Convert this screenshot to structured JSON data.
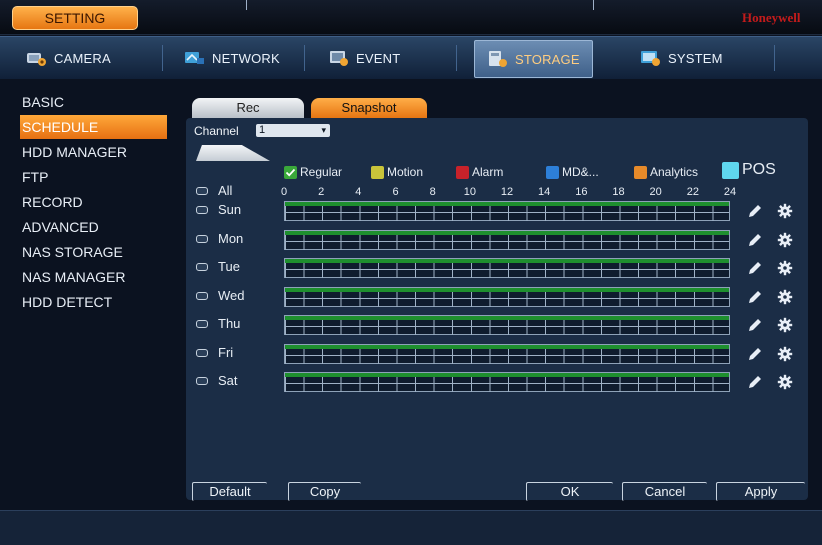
{
  "topbar": {
    "setting_label": "SETTING",
    "brand": "Honeywell"
  },
  "nav": {
    "tabs": [
      {
        "label": "CAMERA",
        "icon": "camera-icon"
      },
      {
        "label": "NETWORK",
        "icon": "network-icon"
      },
      {
        "label": "EVENT",
        "icon": "event-icon"
      },
      {
        "label": "STORAGE",
        "icon": "storage-icon",
        "active": true
      },
      {
        "label": "SYSTEM",
        "icon": "system-icon"
      }
    ]
  },
  "sidebar": {
    "items": [
      {
        "label": "BASIC"
      },
      {
        "label": "SCHEDULE",
        "active": true
      },
      {
        "label": "HDD MANAGER"
      },
      {
        "label": "FTP"
      },
      {
        "label": "RECORD"
      },
      {
        "label": "ADVANCED"
      },
      {
        "label": "NAS STORAGE"
      },
      {
        "label": "NAS MANAGER"
      },
      {
        "label": "HDD DETECT"
      }
    ]
  },
  "schedule": {
    "tabs": [
      {
        "label": "Rec"
      },
      {
        "label": "Snapshot",
        "active": true
      }
    ],
    "channel_label": "Channel",
    "channel_value": "1",
    "legend": [
      {
        "label": "Regular",
        "color": "#3aa83a",
        "checked": true
      },
      {
        "label": "Motion",
        "color": "#c9c43a"
      },
      {
        "label": "Alarm",
        "color": "#c8222a"
      },
      {
        "label": "MD&...",
        "color": "#2d7fd8"
      },
      {
        "label": "Analytics",
        "color": "#e68a2a"
      },
      {
        "label": "POS",
        "color": "#5fd7ef"
      }
    ],
    "all_label": "All",
    "hours": [
      "0",
      "2",
      "4",
      "6",
      "8",
      "10",
      "12",
      "14",
      "16",
      "18",
      "20",
      "22",
      "24"
    ],
    "days": [
      {
        "label": "Sun",
        "regular_coverage": 1.0
      },
      {
        "label": "Mon",
        "regular_coverage": 1.0
      },
      {
        "label": "Tue",
        "regular_coverage": 1.0
      },
      {
        "label": "Wed",
        "regular_coverage": 1.0
      },
      {
        "label": "Thu",
        "regular_coverage": 1.0
      },
      {
        "label": "Fri",
        "regular_coverage": 1.0
      },
      {
        "label": "Sat",
        "regular_coverage": 1.0
      }
    ],
    "row_icons": {
      "edit": "pencil-icon",
      "settings": "gear-icon"
    }
  },
  "buttons": {
    "default": "Default",
    "copy": "Copy",
    "ok": "OK",
    "cancel": "Cancel",
    "apply": "Apply"
  }
}
